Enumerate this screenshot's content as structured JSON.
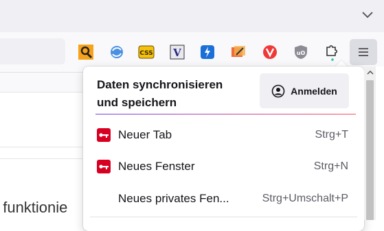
{
  "toolbar": {
    "icons": [
      "search-extension-icon",
      "sync-extension-icon",
      "css-extension-icon",
      "vimium-extension-icon",
      "bolt-extension-icon",
      "edit-extension-icon",
      "vivaldi-extension-icon",
      "ublock-extension-icon",
      "extensions-puzzle-icon",
      "hamburger-menu-icon"
    ]
  },
  "page": {
    "partial_text": "t funktionie"
  },
  "panel": {
    "sync_title": "Daten synchronisieren und speichern",
    "signin_label": "Anmelden",
    "items": [
      {
        "label": "Neuer Tab",
        "shortcut": "Strg+T"
      },
      {
        "label": "Neues Fenster",
        "shortcut": "Strg+N"
      },
      {
        "label": "Neues privates Fen...",
        "shortcut": "Strg+Umschalt+P"
      }
    ]
  },
  "colors": {
    "accent_gradient_start": "#7542e5",
    "accent_gradient_end": "#ff4f5e",
    "menu_icon_red": "#d70022"
  }
}
